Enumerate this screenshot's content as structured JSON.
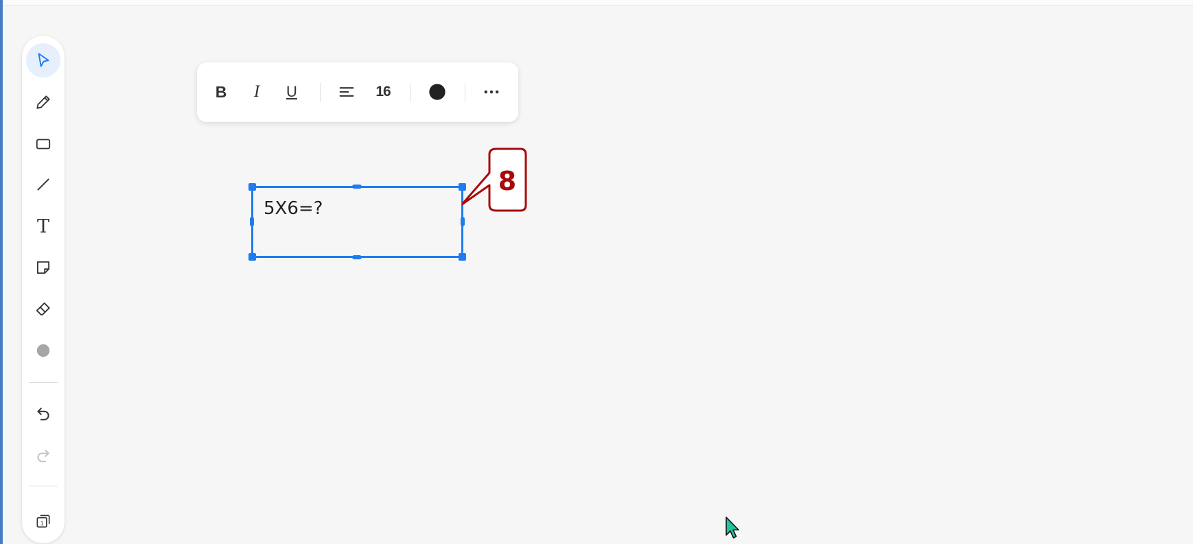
{
  "left_toolbar": {
    "tools": [
      {
        "id": "select",
        "icon": "pointer-icon",
        "active": true
      },
      {
        "id": "pen",
        "icon": "pencil-icon",
        "active": false
      },
      {
        "id": "rectangle",
        "icon": "rectangle-icon",
        "active": false
      },
      {
        "id": "line",
        "icon": "line-icon",
        "active": false
      },
      {
        "id": "text",
        "icon": "text-icon",
        "active": false
      },
      {
        "id": "sticky-note",
        "icon": "sticky-note-icon",
        "active": false
      },
      {
        "id": "eraser",
        "icon": "eraser-icon",
        "active": false
      },
      {
        "id": "color",
        "icon": "color-dot-icon",
        "active": false
      }
    ],
    "text_tool_label": "T",
    "color_swatch": "#a6a6a6",
    "actions": [
      {
        "id": "undo",
        "icon": "undo-icon",
        "enabled": true
      },
      {
        "id": "redo",
        "icon": "redo-icon",
        "enabled": false
      },
      {
        "id": "pages",
        "icon": "pages-icon",
        "enabled": true
      }
    ],
    "pages_count": "1",
    "accent_color": "#1e7cf0"
  },
  "format_toolbar": {
    "bold_label": "B",
    "italic_label": "I",
    "underline_label": "U",
    "align_icon": "align-left-icon",
    "font_size": "16",
    "text_color": "#222222",
    "more_icon": "more-horizontal-icon"
  },
  "canvas": {
    "text_box": {
      "content": "5X6=?",
      "selected": true
    }
  },
  "annotation": {
    "label": "8",
    "color": "#a80a0a"
  }
}
